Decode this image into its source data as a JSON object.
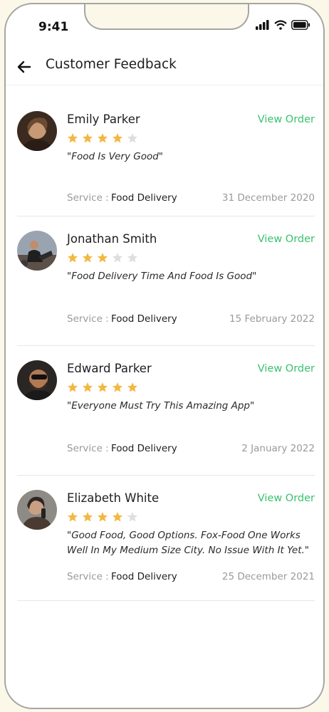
{
  "status_bar": {
    "time": "9:41",
    "icons": [
      "signal-icon",
      "wifi-icon",
      "battery-icon"
    ]
  },
  "header": {
    "title": "Customer Feedback",
    "back_icon": "arrow-left-icon"
  },
  "colors": {
    "accent_green": "#39c26d",
    "star_filled": "#f3b83f",
    "star_empty": "#dedede"
  },
  "reviews": [
    {
      "name": "Emily Parker",
      "action": "View Order",
      "rating": 4,
      "comment": "\"Food Is Very Good\"",
      "service_label": "Service :",
      "service": "Food Delivery",
      "date": "31 December 2020"
    },
    {
      "name": "Jonathan Smith",
      "action": "View Order",
      "rating": 3,
      "comment": "\"Food Delivery Time And Food Is Good\"",
      "service_label": "Service :",
      "service": "Food Delivery",
      "date": "15 February 2022"
    },
    {
      "name": "Edward Parker",
      "action": "View Order",
      "rating": 5,
      "comment": "\"Everyone Must Try This Amazing App\"",
      "service_label": "Service :",
      "service": "Food Delivery",
      "date": "2 January 2022"
    },
    {
      "name": "Elizabeth White",
      "action": "View Order",
      "rating": 4,
      "comment": "\"Good Food, Good Options. Fox-Food One Works Well In My Medium Size City. No Issue With It Yet.\"",
      "service_label": "Service :",
      "service": "Food Delivery",
      "date": "25 December 2021"
    }
  ]
}
